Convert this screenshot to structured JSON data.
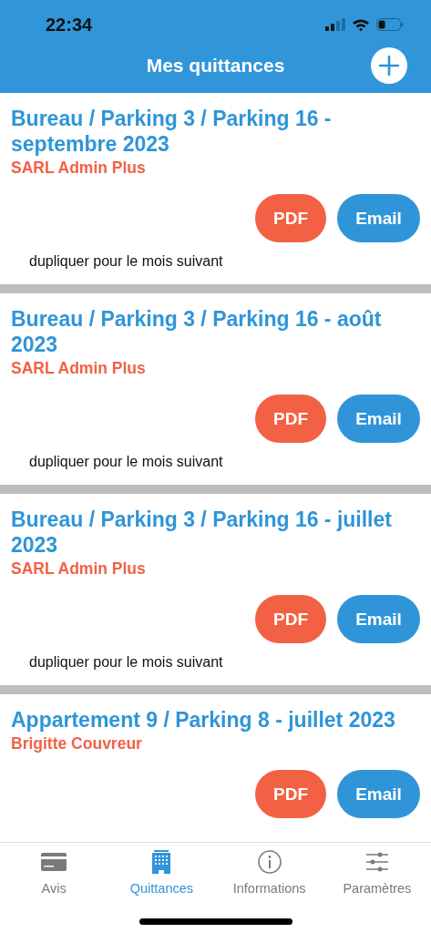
{
  "status_bar": {
    "time": "22:34"
  },
  "header": {
    "title": "Mes quittances"
  },
  "receipts": [
    {
      "title": "Bureau / Parking 3 / Parking 16 - septembre 2023",
      "tenant": "SARL Admin Plus",
      "pdf": "PDF",
      "email": "Email",
      "duplicate": "dupliquer pour le mois suivant"
    },
    {
      "title": "Bureau / Parking 3 / Parking 16 - août 2023",
      "tenant": "SARL Admin Plus",
      "pdf": "PDF",
      "email": "Email",
      "duplicate": "dupliquer pour le mois suivant"
    },
    {
      "title": "Bureau / Parking 3 / Parking 16 - juillet 2023",
      "tenant": "SARL Admin Plus",
      "pdf": "PDF",
      "email": "Email",
      "duplicate": "dupliquer pour le mois suivant"
    },
    {
      "title": "Appartement 9 / Parking 8 - juillet 2023",
      "tenant": "Brigitte Couvreur",
      "pdf": "PDF",
      "email": "Email"
    }
  ],
  "tab_bar": [
    {
      "kind": "card",
      "label": "Avis",
      "selected": false
    },
    {
      "kind": "building",
      "label": "Quittances",
      "selected": true
    },
    {
      "kind": "info",
      "label": "Informations",
      "selected": false
    },
    {
      "kind": "sliders",
      "label": "Paramètres",
      "selected": false
    }
  ]
}
